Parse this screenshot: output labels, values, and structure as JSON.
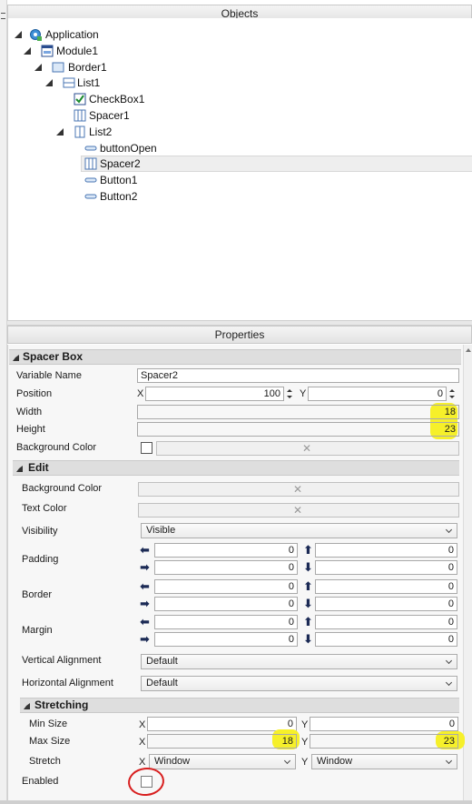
{
  "objects_panel": {
    "title": "Objects"
  },
  "tree": [
    {
      "label": "Application",
      "icon": "application-icon"
    },
    {
      "label": "Module1",
      "icon": "module-icon"
    },
    {
      "label": "Border1",
      "icon": "border-icon"
    },
    {
      "label": "List1",
      "icon": "list-icon"
    },
    {
      "label": "CheckBox1",
      "icon": "checkbox-icon"
    },
    {
      "label": "Spacer1",
      "icon": "spacer-icon"
    },
    {
      "label": "List2",
      "icon": "list-vertical-icon"
    },
    {
      "label": "buttonOpen",
      "icon": "button-icon"
    },
    {
      "label": "Spacer2",
      "icon": "spacer-icon",
      "selected": true
    },
    {
      "label": "Button1",
      "icon": "button-icon"
    },
    {
      "label": "Button2",
      "icon": "button-icon"
    }
  ],
  "properties_panel": {
    "title": "Properties"
  },
  "spacer_box": {
    "section": "Spacer Box",
    "variable_name_label": "Variable Name",
    "variable_name_value": "Spacer2",
    "position_label": "Position",
    "x_axis": "X",
    "y_axis": "Y",
    "position_x": "100",
    "position_y": "0",
    "width_label": "Width",
    "width_value": "18",
    "height_label": "Height",
    "height_value": "23",
    "background_color_label": "Background Color",
    "x_mark": "✕"
  },
  "edit": {
    "section": "Edit",
    "background_color_label": "Background Color",
    "text_color_label": "Text Color",
    "visibility_label": "Visibility",
    "visibility_value": "Visible",
    "padding_label": "Padding",
    "border_label": "Border",
    "margin_label": "Margin",
    "padding": {
      "left": "0",
      "top": "0",
      "right": "0",
      "bottom": "0"
    },
    "border": {
      "left": "0",
      "top": "0",
      "right": "0",
      "bottom": "0"
    },
    "margin": {
      "left": "0",
      "top": "0",
      "right": "0",
      "bottom": "0"
    },
    "vertical_alignment_label": "Vertical Alignment",
    "vertical_alignment_value": "Default",
    "horizontal_alignment_label": "Horizontal Alignment",
    "horizontal_alignment_value": "Default",
    "arrows": {
      "left": "⬅",
      "right": "➡",
      "up": "⬆",
      "down": "⬇"
    }
  },
  "stretching": {
    "section": "Stretching",
    "min_size_label": "Min Size",
    "min_x": "0",
    "min_y": "0",
    "max_size_label": "Max Size",
    "max_x": "18",
    "max_y": "23",
    "stretch_label": "Stretch",
    "stretch_x": "Window",
    "stretch_y": "Window",
    "enabled_label": "Enabled"
  },
  "colors": {
    "highlight": "#f6f02a",
    "annotation_circle": "#d81e1e",
    "selection": "#eeeeee"
  }
}
